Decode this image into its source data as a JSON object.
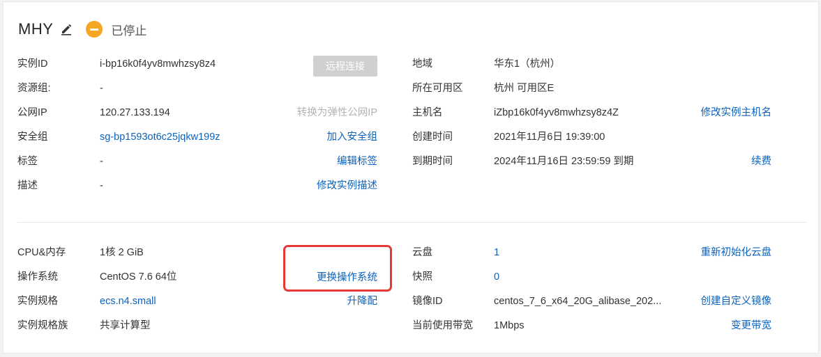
{
  "header": {
    "title": "MHY",
    "status": "已停止"
  },
  "top_left": [
    {
      "label": "实例ID",
      "value": "i-bp16k0f4yv8mwhzsy8z4",
      "action": ""
    },
    {
      "label": "资源组:",
      "value": "-",
      "action": ""
    },
    {
      "label": "公网IP",
      "value": "120.27.133.194",
      "action": "转换为弹性公网IP"
    },
    {
      "label": "安全组",
      "value": "sg-bp1593ot6c25jqkw199z",
      "action": "加入安全组"
    },
    {
      "label": "标签",
      "value": "-",
      "action": "编辑标签"
    },
    {
      "label": "描述",
      "value": "-",
      "action": "修改实例描述"
    }
  ],
  "remote_button": "远程连接",
  "top_right": [
    {
      "label": "地域",
      "value": "华东1（杭州）",
      "action": ""
    },
    {
      "label": "所在可用区",
      "value": "杭州 可用区E",
      "action": ""
    },
    {
      "label": "主机名",
      "value": "iZbp16k0f4yv8mwhzsy8z4Z",
      "action": "修改实例主机名"
    },
    {
      "label": "创建时间",
      "value": "2021年11月6日 19:39:00",
      "action": ""
    },
    {
      "label": "到期时间",
      "value": "2024年11月16日 23:59:59 到期",
      "action": "续费"
    }
  ],
  "bottom_left": [
    {
      "label": "CPU&内存",
      "value": "1核 2 GiB",
      "action": ""
    },
    {
      "label": "操作系统",
      "value": "CentOS 7.6 64位",
      "action": "更换操作系统"
    },
    {
      "label": "实例规格",
      "value": "ecs.n4.small",
      "action": "升降配"
    },
    {
      "label": "实例规格族",
      "value": "共享计算型",
      "action": ""
    }
  ],
  "bottom_right": [
    {
      "label": "云盘",
      "value": "1",
      "action": "重新初始化云盘"
    },
    {
      "label": "快照",
      "value": "0",
      "action": ""
    },
    {
      "label": "镜像ID",
      "value": "centos_7_6_x64_20G_alibase_202...",
      "action": "创建自定义镜像"
    },
    {
      "label": "当前使用带宽",
      "value": "1Mbps",
      "action": "变更带宽"
    }
  ],
  "colors": {
    "link": "#0b62bd",
    "status": "#f5a623",
    "highlight": "#e53935"
  }
}
